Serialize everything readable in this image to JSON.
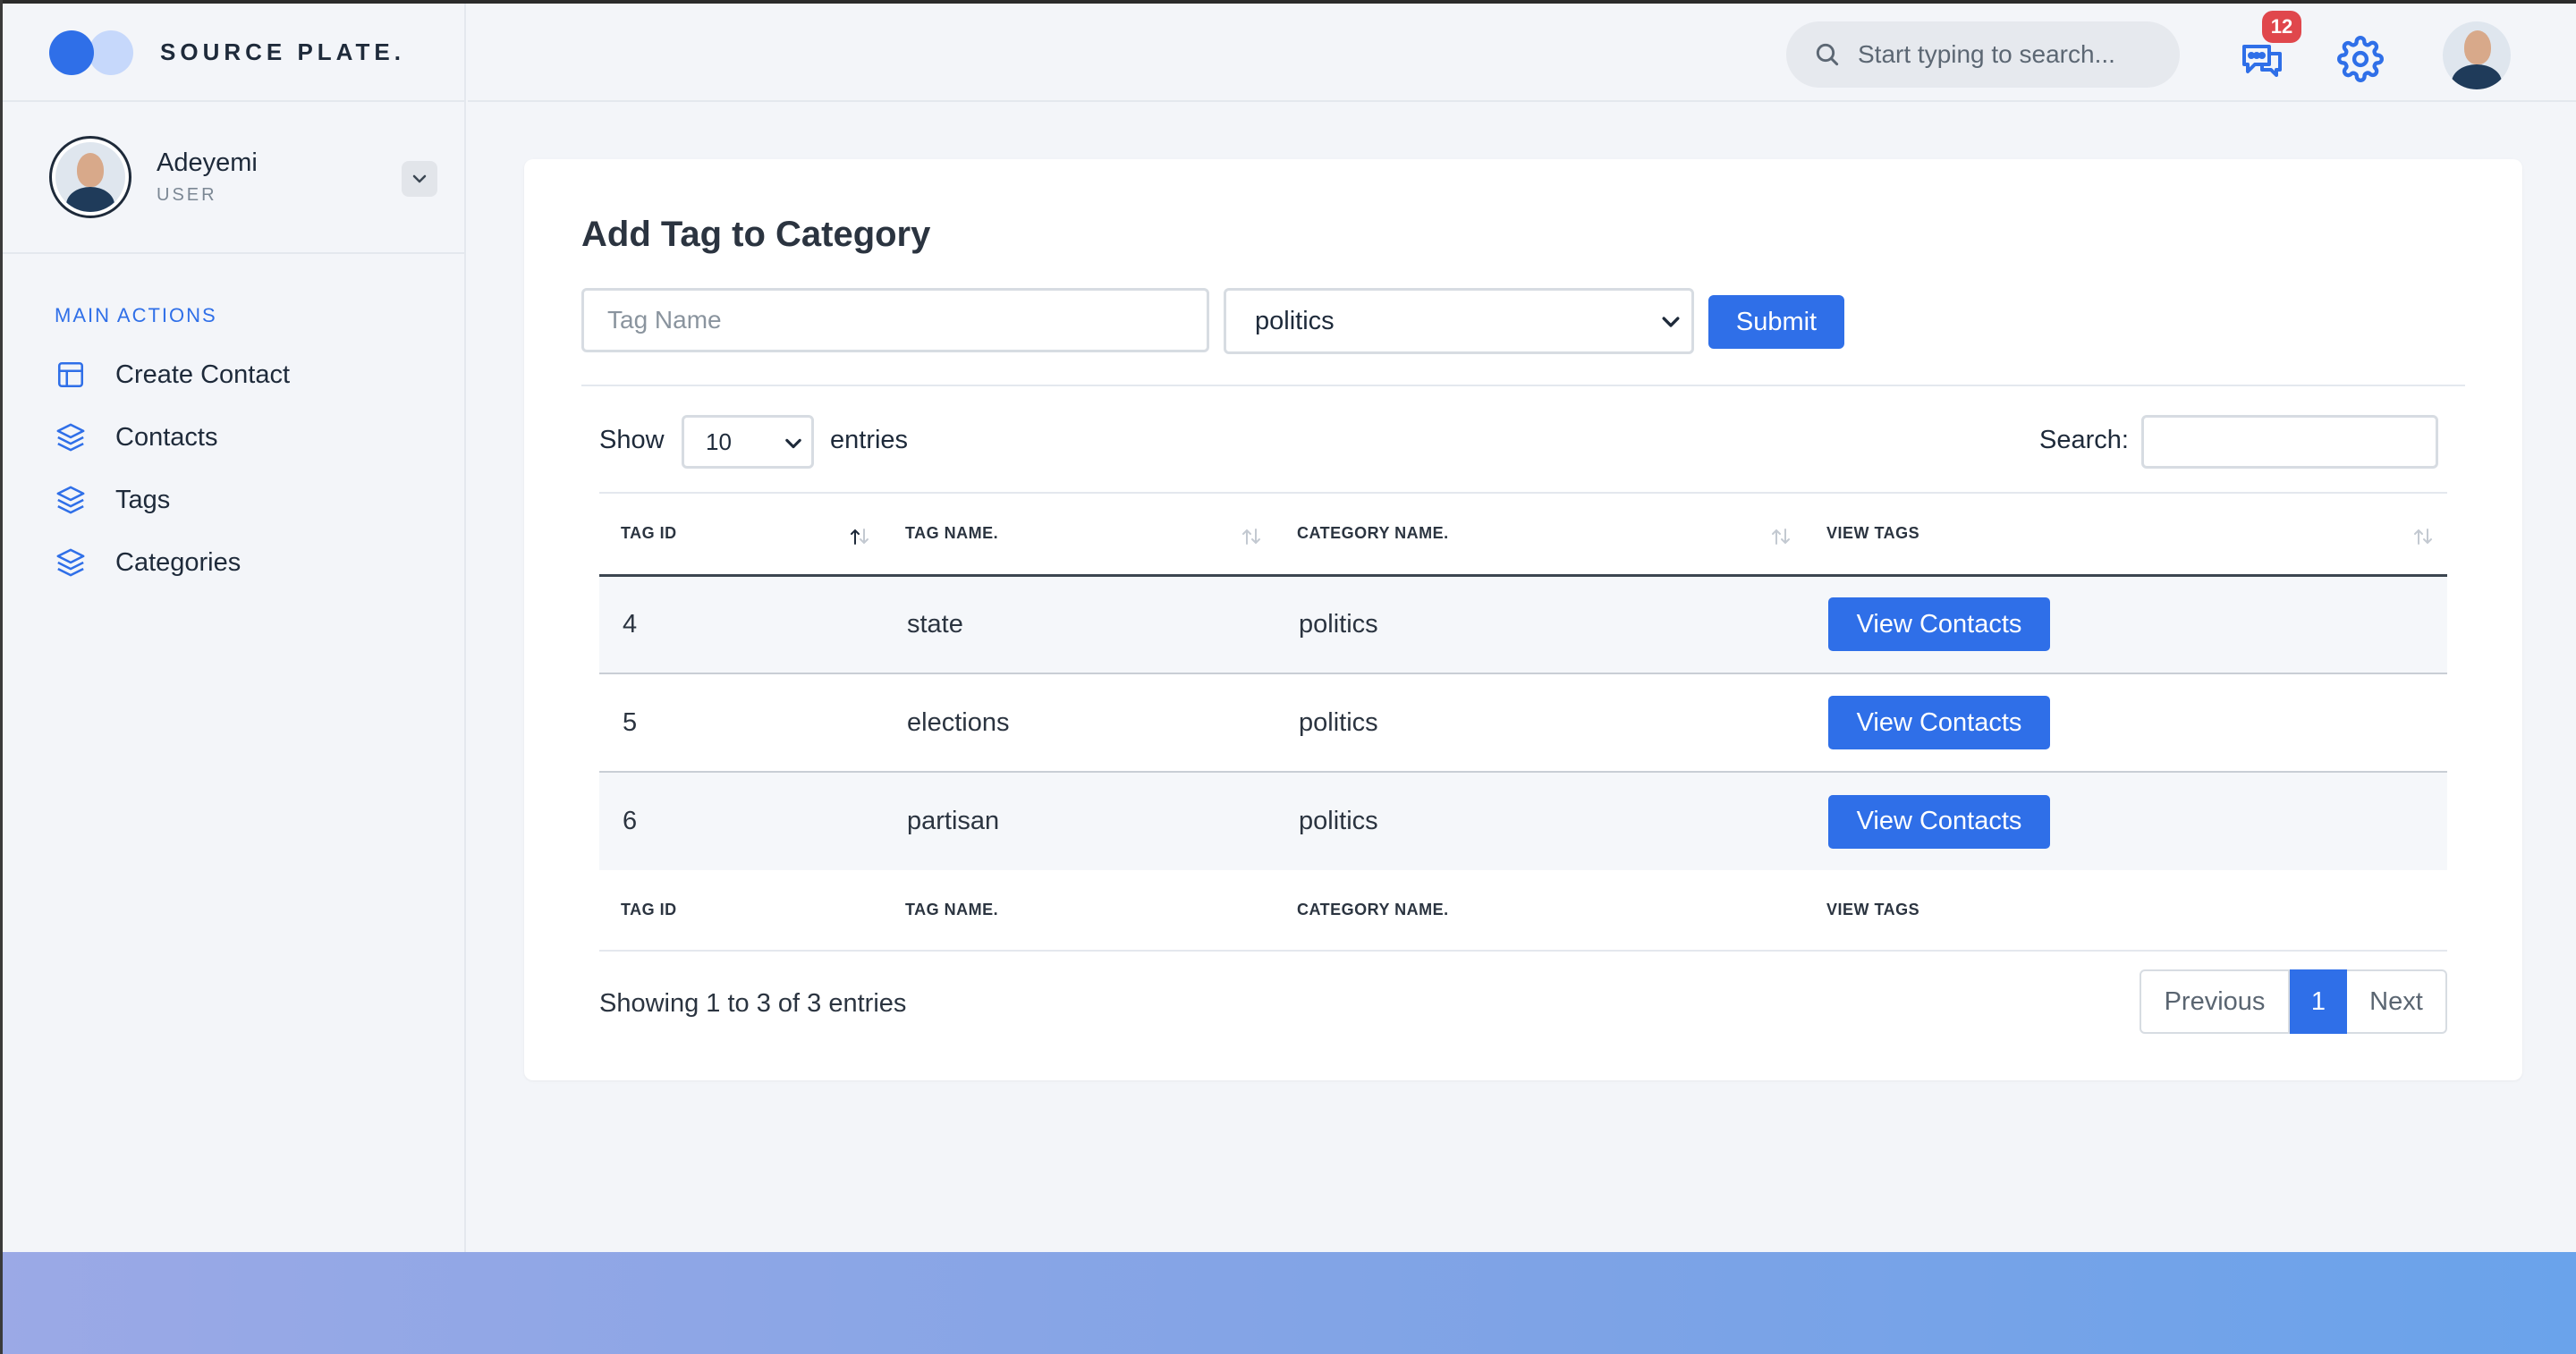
{
  "brand": {
    "name": "SOURCE PLATE."
  },
  "user": {
    "name": "Adeyemi",
    "role": "USER"
  },
  "sidebar": {
    "section_label": "MAIN ACTIONS",
    "items": [
      {
        "label": "Create Contact",
        "icon": "layout-icon"
      },
      {
        "label": "Contacts",
        "icon": "layers-icon"
      },
      {
        "label": "Tags",
        "icon": "layers-icon"
      },
      {
        "label": "Categories",
        "icon": "layers-icon"
      }
    ]
  },
  "topbar": {
    "search_placeholder": "Start typing to search...",
    "notification_count": "12"
  },
  "form": {
    "title": "Add Tag to Category",
    "tag_placeholder": "Tag Name",
    "category_value": "politics",
    "submit_label": "Submit"
  },
  "table": {
    "show_label": "Show",
    "length_value": "10",
    "entries_label": "entries",
    "search_label": "Search:",
    "headers": [
      "TAG ID",
      "TAG NAME.",
      "CATEGORY NAME.",
      "VIEW TAGS"
    ],
    "rows": [
      {
        "id": "4",
        "name": "state",
        "category": "politics",
        "action": "View Contacts"
      },
      {
        "id": "5",
        "name": "elections",
        "category": "politics",
        "action": "View Contacts"
      },
      {
        "id": "6",
        "name": "partisan",
        "category": "politics",
        "action": "View Contacts"
      }
    ],
    "info": "Showing 1 to 3 of 3 entries",
    "pagination": {
      "previous": "Previous",
      "current": "1",
      "next": "Next"
    }
  },
  "colors": {
    "accent": "#2f6fe8",
    "badge": "#e0474c",
    "background": "#f3f5f9"
  }
}
